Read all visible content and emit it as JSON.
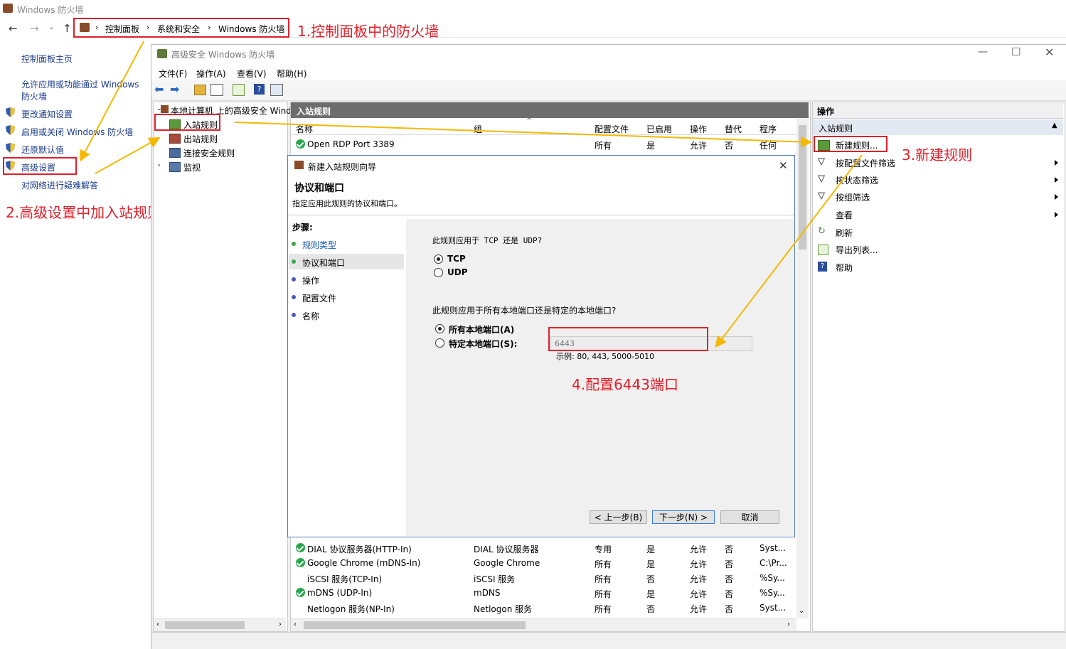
{
  "window": {
    "title": "Windows 防火墙"
  },
  "address_bar": {
    "crumbs": [
      "控制面板",
      "系统和安全",
      "Windows 防火墙"
    ]
  },
  "left_nav": {
    "home": "控制面板主页",
    "allow_app": "允许应用或功能通过 Windows",
    "allow_app_2": "防火墙",
    "change_notify": "更改通知设置",
    "toggle": "启用或关闭 Windows 防火墙",
    "restore": "还原默认值",
    "advanced": "高级设置",
    "troubleshoot": "对网络进行疑难解答"
  },
  "annotations": {
    "a1": "1.控制面板中的防火墙",
    "a2": "2.高级设置中加入站规则",
    "a3": "3.新建规则",
    "a4": "4.配置6443端口"
  },
  "mmc": {
    "title": "高级安全 Windows 防火墙",
    "menus": [
      "文件(F)",
      "操作(A)",
      "查看(V)",
      "帮助(H)"
    ],
    "tree": {
      "root": "本地计算机 上的高级安全 Wind",
      "inbound": "入站规则",
      "outbound": "出站规则",
      "connection": "连接安全规则",
      "monitor": "监视"
    },
    "center_header": "入站规则",
    "columns": [
      "名称",
      "组",
      "配置文件",
      "已启用",
      "操作",
      "替代",
      "程序"
    ],
    "top_row": {
      "name": "Open RDP Port 3389",
      "group": "",
      "profile": "所有",
      "enabled": "是",
      "action": "允许",
      "override": "否",
      "program": "任何"
    },
    "rows": [
      {
        "name": "DIAL 协议服务器(HTTP-In)",
        "group": "DIAL 协议服务器",
        "profile": "专用",
        "enabled": "是",
        "action": "允许",
        "override": "否",
        "program": "Syst...",
        "check": true
      },
      {
        "name": "Google Chrome (mDNS-In)",
        "group": "Google Chrome",
        "profile": "所有",
        "enabled": "是",
        "action": "允许",
        "override": "否",
        "program": "C:\\Pr...",
        "check": true
      },
      {
        "name": "iSCSI 服务(TCP-In)",
        "group": "iSCSI 服务",
        "profile": "所有",
        "enabled": "否",
        "action": "允许",
        "override": "否",
        "program": "%Sy...",
        "check": false
      },
      {
        "name": "mDNS (UDP-In)",
        "group": "mDNS",
        "profile": "所有",
        "enabled": "是",
        "action": "允许",
        "override": "否",
        "program": "%Sy...",
        "check": true
      },
      {
        "name": "Netlogon 服务(NP-In)",
        "group": "Netlogon 服务",
        "profile": "所有",
        "enabled": "否",
        "action": "允许",
        "override": "否",
        "program": "Syst...",
        "check": false
      }
    ],
    "actions": {
      "header": "操作",
      "section": "入站规则",
      "new_rule": "新建规则...",
      "filter_profile": "按配置文件筛选",
      "filter_state": "按状态筛选",
      "filter_group": "按组筛选",
      "view": "查看",
      "refresh": "刷新",
      "export": "导出列表...",
      "help": "帮助"
    }
  },
  "wizard": {
    "title": "新建入站规则向导",
    "heading": "协议和端口",
    "subheading": "指定应用此规则的协议和端口。",
    "steps_label": "步骤:",
    "steps": [
      "规则类型",
      "协议和端口",
      "操作",
      "配置文件",
      "名称"
    ],
    "q_protocol": "此规则应用于 TCP 还是 UDP?",
    "tcp": "TCP",
    "udp": "UDP",
    "q_ports": "此规则应用于所有本地端口还是特定的本地端口?",
    "all_ports": "所有本地端口(A)",
    "specific_ports": "特定本地端口(S):",
    "port_value": "6443",
    "example": "示例: 80, 443, 5000-5010",
    "btn_back": "< 上一步(B)",
    "btn_next": "下一步(N) >",
    "btn_cancel": "取消"
  }
}
